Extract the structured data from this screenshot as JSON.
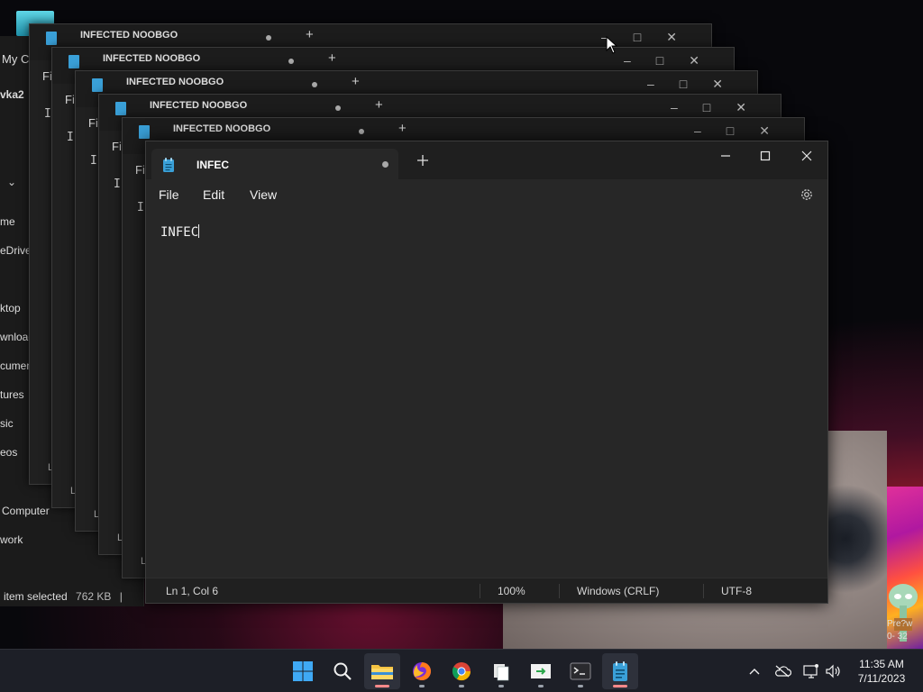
{
  "desktop": {
    "icon_label": "My C",
    "shortcut_label": "Pre?w",
    "shortcut_sub": "0- 32"
  },
  "explorer": {
    "title": "My C",
    "user": "vka2",
    "nav_items": [
      "me",
      "eDrive",
      "",
      "ktop",
      "wnload",
      "cumen",
      "tures",
      "sic",
      "eos"
    ],
    "computer": "Computer",
    "network": "work",
    "status_selected": "item selected",
    "status_size": "762 KB",
    "status_bar": "|"
  },
  "stacked_windows": [
    {
      "title": "INFECTED NOOBGO",
      "menu": "Fi",
      "text": "I"
    },
    {
      "title": "INFECTED NOOBGO",
      "menu": "Fi",
      "text": "I"
    },
    {
      "title": "INFECTED NOOBGO",
      "menu": "Fi",
      "text": "I"
    },
    {
      "title": "INFECTED NOOBGO",
      "menu": "Fi",
      "text": "I"
    },
    {
      "title": "INFECTED NOOBGO",
      "menu": "Fi",
      "text": "I"
    }
  ],
  "stacked_status": "L",
  "notepad": {
    "tab_title": "INFEC",
    "menu": {
      "file": "File",
      "edit": "Edit",
      "view": "View"
    },
    "content": "INFEC",
    "status": {
      "position": "Ln 1, Col 6",
      "zoom": "100%",
      "line_ending": "Windows (CRLF)",
      "encoding": "UTF-8"
    }
  },
  "taskbar": {
    "apps": [
      "start",
      "search",
      "file-explorer",
      "firefox",
      "chrome",
      "files",
      "remote-app",
      "terminal",
      "notepad"
    ],
    "clock_time": "11:35 AM",
    "clock_date": "7/11/2023"
  },
  "colors": {
    "notepad_icon": "#3aa0d8",
    "active_indicator": "#ff8a8a",
    "taskbar_bg": "#1d1f27"
  }
}
